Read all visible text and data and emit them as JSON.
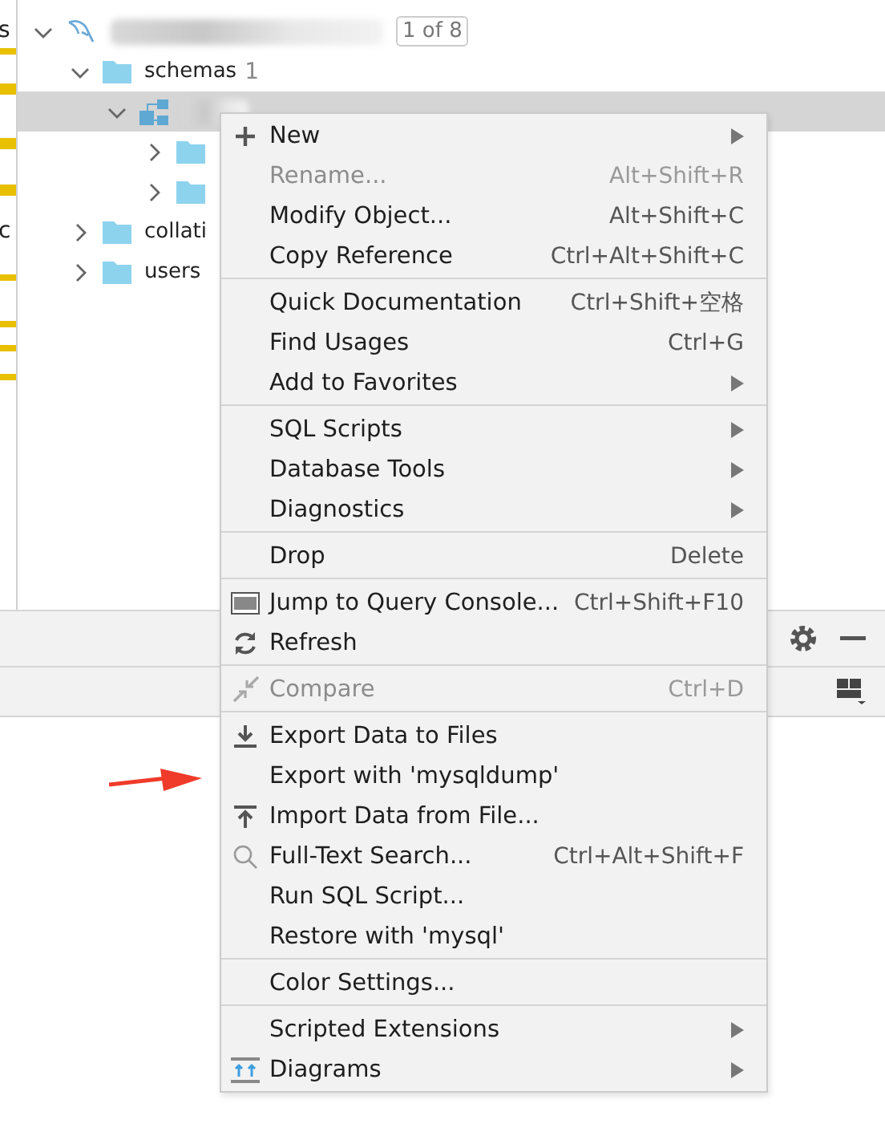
{
  "edge_texts": [
    "s",
    "c"
  ],
  "tree": [
    {
      "kind": "database",
      "badge": "1 of 8",
      "expanded": true,
      "selected": false,
      "children": [
        {
          "kind": "folder",
          "label": "schemas",
          "count": "1",
          "expanded": true,
          "selected": false,
          "children": [
            {
              "kind": "schema",
              "expanded": true,
              "selected": true,
              "children": [
                {
                  "kind": "folder",
                  "expanded": false,
                  "selected": false
                },
                {
                  "kind": "folder",
                  "expanded": false,
                  "selected": false
                }
              ]
            }
          ]
        },
        {
          "kind": "folder",
          "label": "collati",
          "expanded": false,
          "selected": false
        },
        {
          "kind": "folder",
          "label": "users",
          "expanded": false,
          "selected": false
        }
      ]
    }
  ],
  "menu": [
    {
      "kind": "plus",
      "label": "New",
      "submenu": true,
      "disabled": false
    },
    {
      "kind": "item",
      "label": "Rename...",
      "shortcut": "Alt+Shift+R",
      "submenu": false,
      "disabled": true
    },
    {
      "kind": "item",
      "label": "Modify Object...",
      "shortcut": "Alt+Shift+C",
      "submenu": false,
      "disabled": false
    },
    {
      "kind": "item",
      "label": "Copy Reference",
      "shortcut": "Ctrl+Alt+Shift+C",
      "submenu": false,
      "disabled": false
    },
    {
      "kind": "separator"
    },
    {
      "kind": "item",
      "label": "Quick Documentation",
      "shortcut": "Ctrl+Shift+空格",
      "submenu": false,
      "disabled": false
    },
    {
      "kind": "item",
      "label": "Find Usages",
      "shortcut": "Ctrl+G",
      "submenu": false,
      "disabled": false
    },
    {
      "kind": "item",
      "label": "Add to Favorites",
      "submenu": true,
      "disabled": false
    },
    {
      "kind": "separator"
    },
    {
      "kind": "item",
      "label": "SQL Scripts",
      "submenu": true,
      "disabled": false
    },
    {
      "kind": "item",
      "label": "Database Tools",
      "submenu": true,
      "disabled": false
    },
    {
      "kind": "item",
      "label": "Diagnostics",
      "submenu": true,
      "disabled": false
    },
    {
      "kind": "separator"
    },
    {
      "kind": "item",
      "label": "Drop",
      "shortcut": "Delete",
      "submenu": false,
      "disabled": false
    },
    {
      "kind": "separator"
    },
    {
      "kind": "console",
      "label": "Jump to Query Console...",
      "shortcut": "Ctrl+Shift+F10",
      "submenu": false,
      "disabled": false
    },
    {
      "kind": "refresh",
      "label": "Refresh",
      "submenu": false,
      "disabled": false
    },
    {
      "kind": "separator"
    },
    {
      "kind": "compare",
      "label": "Compare",
      "shortcut": "Ctrl+D",
      "submenu": false,
      "disabled": true
    },
    {
      "kind": "separator"
    },
    {
      "kind": "export",
      "label": "Export Data to Files",
      "submenu": false,
      "disabled": false
    },
    {
      "kind": "item",
      "label": "Export with 'mysqldump'",
      "submenu": false,
      "disabled": false
    },
    {
      "kind": "import",
      "label": "Import Data from File...",
      "submenu": false,
      "disabled": false
    },
    {
      "kind": "search",
      "label": "Full-Text Search...",
      "shortcut": "Ctrl+Alt+Shift+F",
      "submenu": false,
      "disabled": false
    },
    {
      "kind": "item",
      "label": "Run SQL Script...",
      "submenu": false,
      "disabled": false
    },
    {
      "kind": "item",
      "label": "Restore with 'mysql'",
      "submenu": false,
      "disabled": false
    },
    {
      "kind": "separator"
    },
    {
      "kind": "item",
      "label": "Color Settings...",
      "submenu": false,
      "disabled": false
    },
    {
      "kind": "separator"
    },
    {
      "kind": "item",
      "label": "Scripted Extensions",
      "submenu": true,
      "disabled": false
    },
    {
      "kind": "diagram",
      "label": "Diagrams",
      "submenu": true,
      "disabled": false
    }
  ]
}
